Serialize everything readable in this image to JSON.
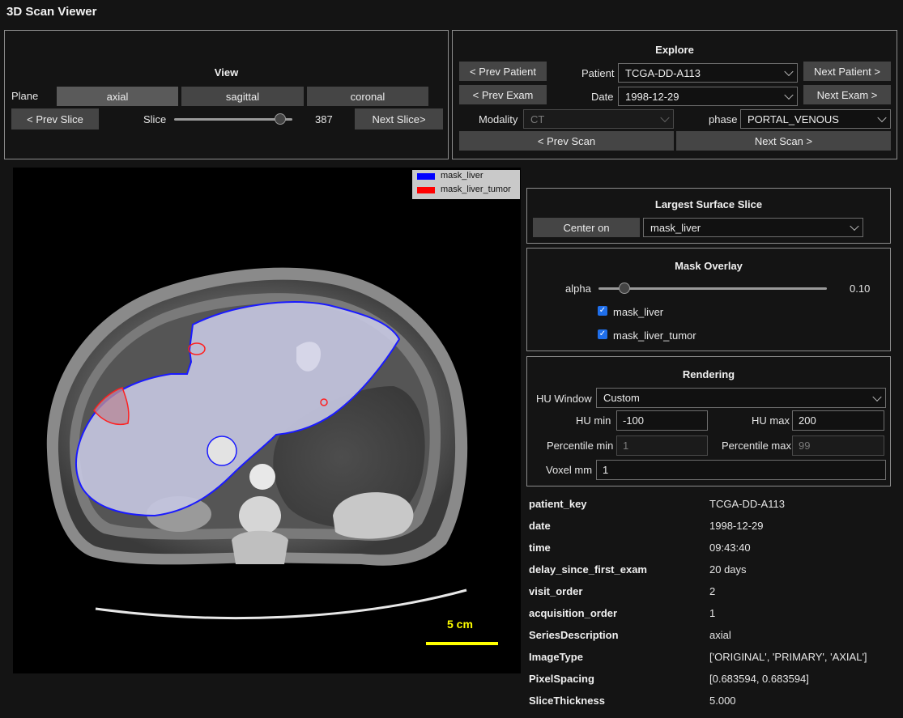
{
  "app": {
    "title": "3D Scan Viewer"
  },
  "view": {
    "title": "View",
    "plane_label": "Plane",
    "planes": [
      "axial",
      "sagittal",
      "coronal"
    ],
    "prev_slice": "< Prev Slice",
    "slice_label": "Slice",
    "slice_value": "387",
    "next_slice": "Next Slice>"
  },
  "explore": {
    "title": "Explore",
    "prev_patient": "< Prev Patient",
    "patient_label": "Patient",
    "patient_value": "TCGA-DD-A113",
    "next_patient": "Next Patient >",
    "prev_exam": "< Prev Exam",
    "date_label": "Date",
    "date_value": "1998-12-29",
    "next_exam": "Next Exam >",
    "modality_label": "Modality",
    "modality_value": "CT",
    "phase_label": "phase",
    "phase_value": "PORTAL_VENOUS",
    "prev_scan": "< Prev Scan",
    "next_scan": "Next Scan >"
  },
  "image": {
    "legend": [
      {
        "label": "mask_liver",
        "color": "#0000ff"
      },
      {
        "label": "mask_liver_tumor",
        "color": "#ff0000"
      }
    ],
    "scale_label": "5 cm",
    "scale_color": "#ffff00"
  },
  "largest_surface": {
    "title": "Largest Surface Slice",
    "center_button": "Center on",
    "mask_value": "mask_liver"
  },
  "mask_overlay": {
    "title": "Mask Overlay",
    "alpha_label": "alpha",
    "alpha_value": "0.10",
    "alpha_fraction": 0.1,
    "masks": [
      {
        "label": "mask_liver",
        "checked": true
      },
      {
        "label": "mask_liver_tumor",
        "checked": true
      }
    ]
  },
  "rendering": {
    "title": "Rendering",
    "hu_window_label": "HU Window",
    "hu_window_value": "Custom",
    "hu_min_label": "HU min",
    "hu_min_value": "-100",
    "hu_max_label": "HU max",
    "hu_max_value": "200",
    "pmin_label": "Percentile min",
    "pmin_value": "1",
    "pmax_label": "Percentile max",
    "pmax_value": "99",
    "voxel_label": "Voxel mm",
    "voxel_value": "1"
  },
  "metadata": [
    {
      "key": "patient_key",
      "value": "TCGA-DD-A113"
    },
    {
      "key": "date",
      "value": "1998-12-29"
    },
    {
      "key": "time",
      "value": "09:43:40"
    },
    {
      "key": "delay_since_first_exam",
      "value": "20 days"
    },
    {
      "key": "visit_order",
      "value": "2"
    },
    {
      "key": "acquisition_order",
      "value": "1"
    },
    {
      "key": "SeriesDescription",
      "value": "axial"
    },
    {
      "key": "ImageType",
      "value": "['ORIGINAL', 'PRIMARY', 'AXIAL']"
    },
    {
      "key": "PixelSpacing",
      "value": "[0.683594, 0.683594]"
    },
    {
      "key": "SliceThickness",
      "value": "5.000"
    }
  ]
}
